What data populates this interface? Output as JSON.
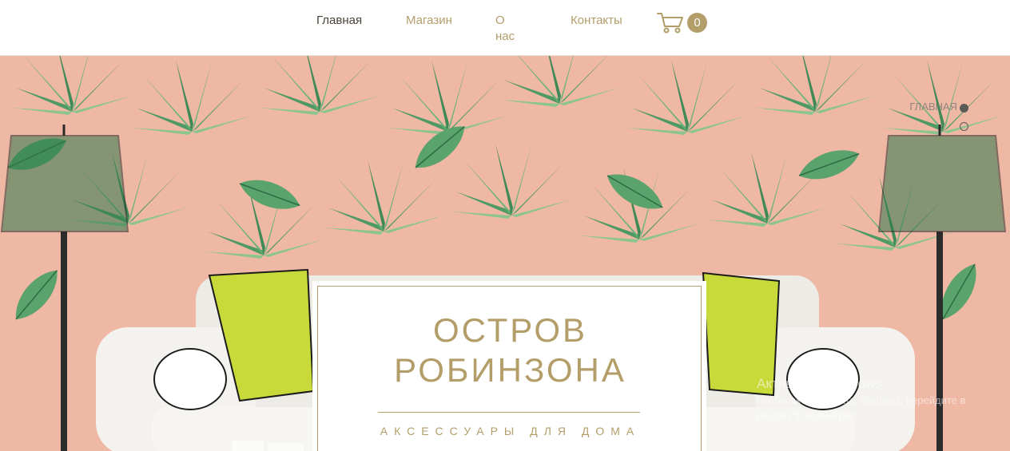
{
  "nav": {
    "items": [
      {
        "label": "Главная",
        "active": true
      },
      {
        "label": "Магазин",
        "active": false
      },
      {
        "label": "О нас",
        "active": false
      },
      {
        "label": "Контакты",
        "active": false
      }
    ]
  },
  "cart": {
    "icon": "cart-icon",
    "count": "0"
  },
  "hero": {
    "title_line1": "ОСТРОВ",
    "title_line2": "РОБИНЗОНА",
    "subtitle": "АКСЕССУАРЫ ДЛЯ ДОМА"
  },
  "anchor_nav": {
    "active_label": "ГЛАВНАЯ"
  },
  "watermark": {
    "title": "Активация Windows",
    "line1": "Чтобы активировать Windows, перейдите в",
    "line2": "раздел \"Параметры\"."
  },
  "colors": {
    "accent": "#b39e6a",
    "nav_active": "#4a4437",
    "hero_bg": "#efb8a5",
    "leaf": "#4f9a64"
  }
}
